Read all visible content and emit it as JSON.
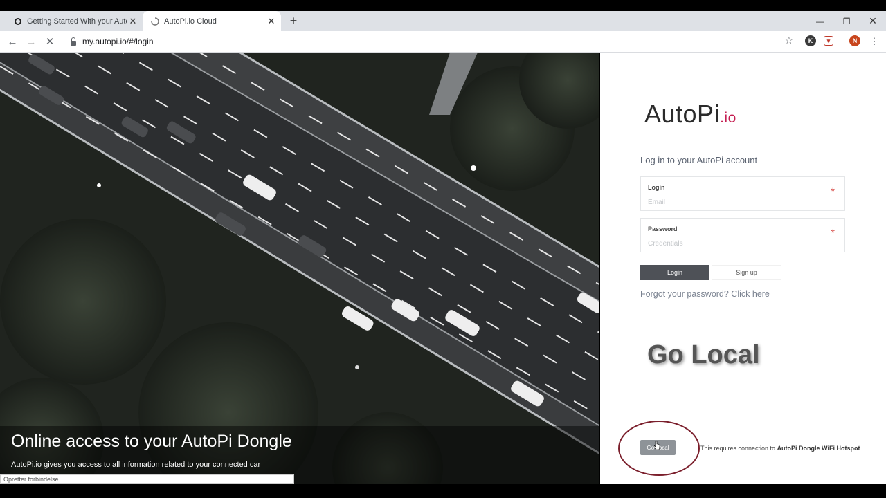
{
  "browser": {
    "tabs": [
      {
        "label": "Getting Started With your AutoPi",
        "active": false
      },
      {
        "label": "AutoPi.io Cloud",
        "active": true
      }
    ],
    "new_tab_icon": "plus-icon",
    "url": "my.autopi.io/#/login",
    "profile_initial": "N",
    "ext_initial": "K",
    "status_text": "Opretter forbindelse..."
  },
  "hero": {
    "title": "Online access to your AutoPi Dongle",
    "subtitle": "AutoPi.io gives you access to all information related to your connected car"
  },
  "login": {
    "logo_main": "AutoPi",
    "logo_suffix": ".io",
    "headline": "Log in to your AutoPi account",
    "fields": [
      {
        "label": "Login",
        "placeholder": "Email",
        "required_mark": "*"
      },
      {
        "label": "Password",
        "placeholder": "Credentials",
        "required_mark": "*"
      }
    ],
    "login_button": "Login",
    "signup_button": "Sign up",
    "forgot_link": "Forgot your password? Click here"
  },
  "go_local": {
    "overlay_title": "Go Local",
    "button_label": "Go Local",
    "note_prefix": "This requires connection to ",
    "note_bold": "AutoPi Dongle WiFi Hotspot"
  },
  "colors": {
    "logo_accent": "#c51f52",
    "login_button_bg": "#4e5157",
    "highlight_circle": "#7b1f2c"
  }
}
